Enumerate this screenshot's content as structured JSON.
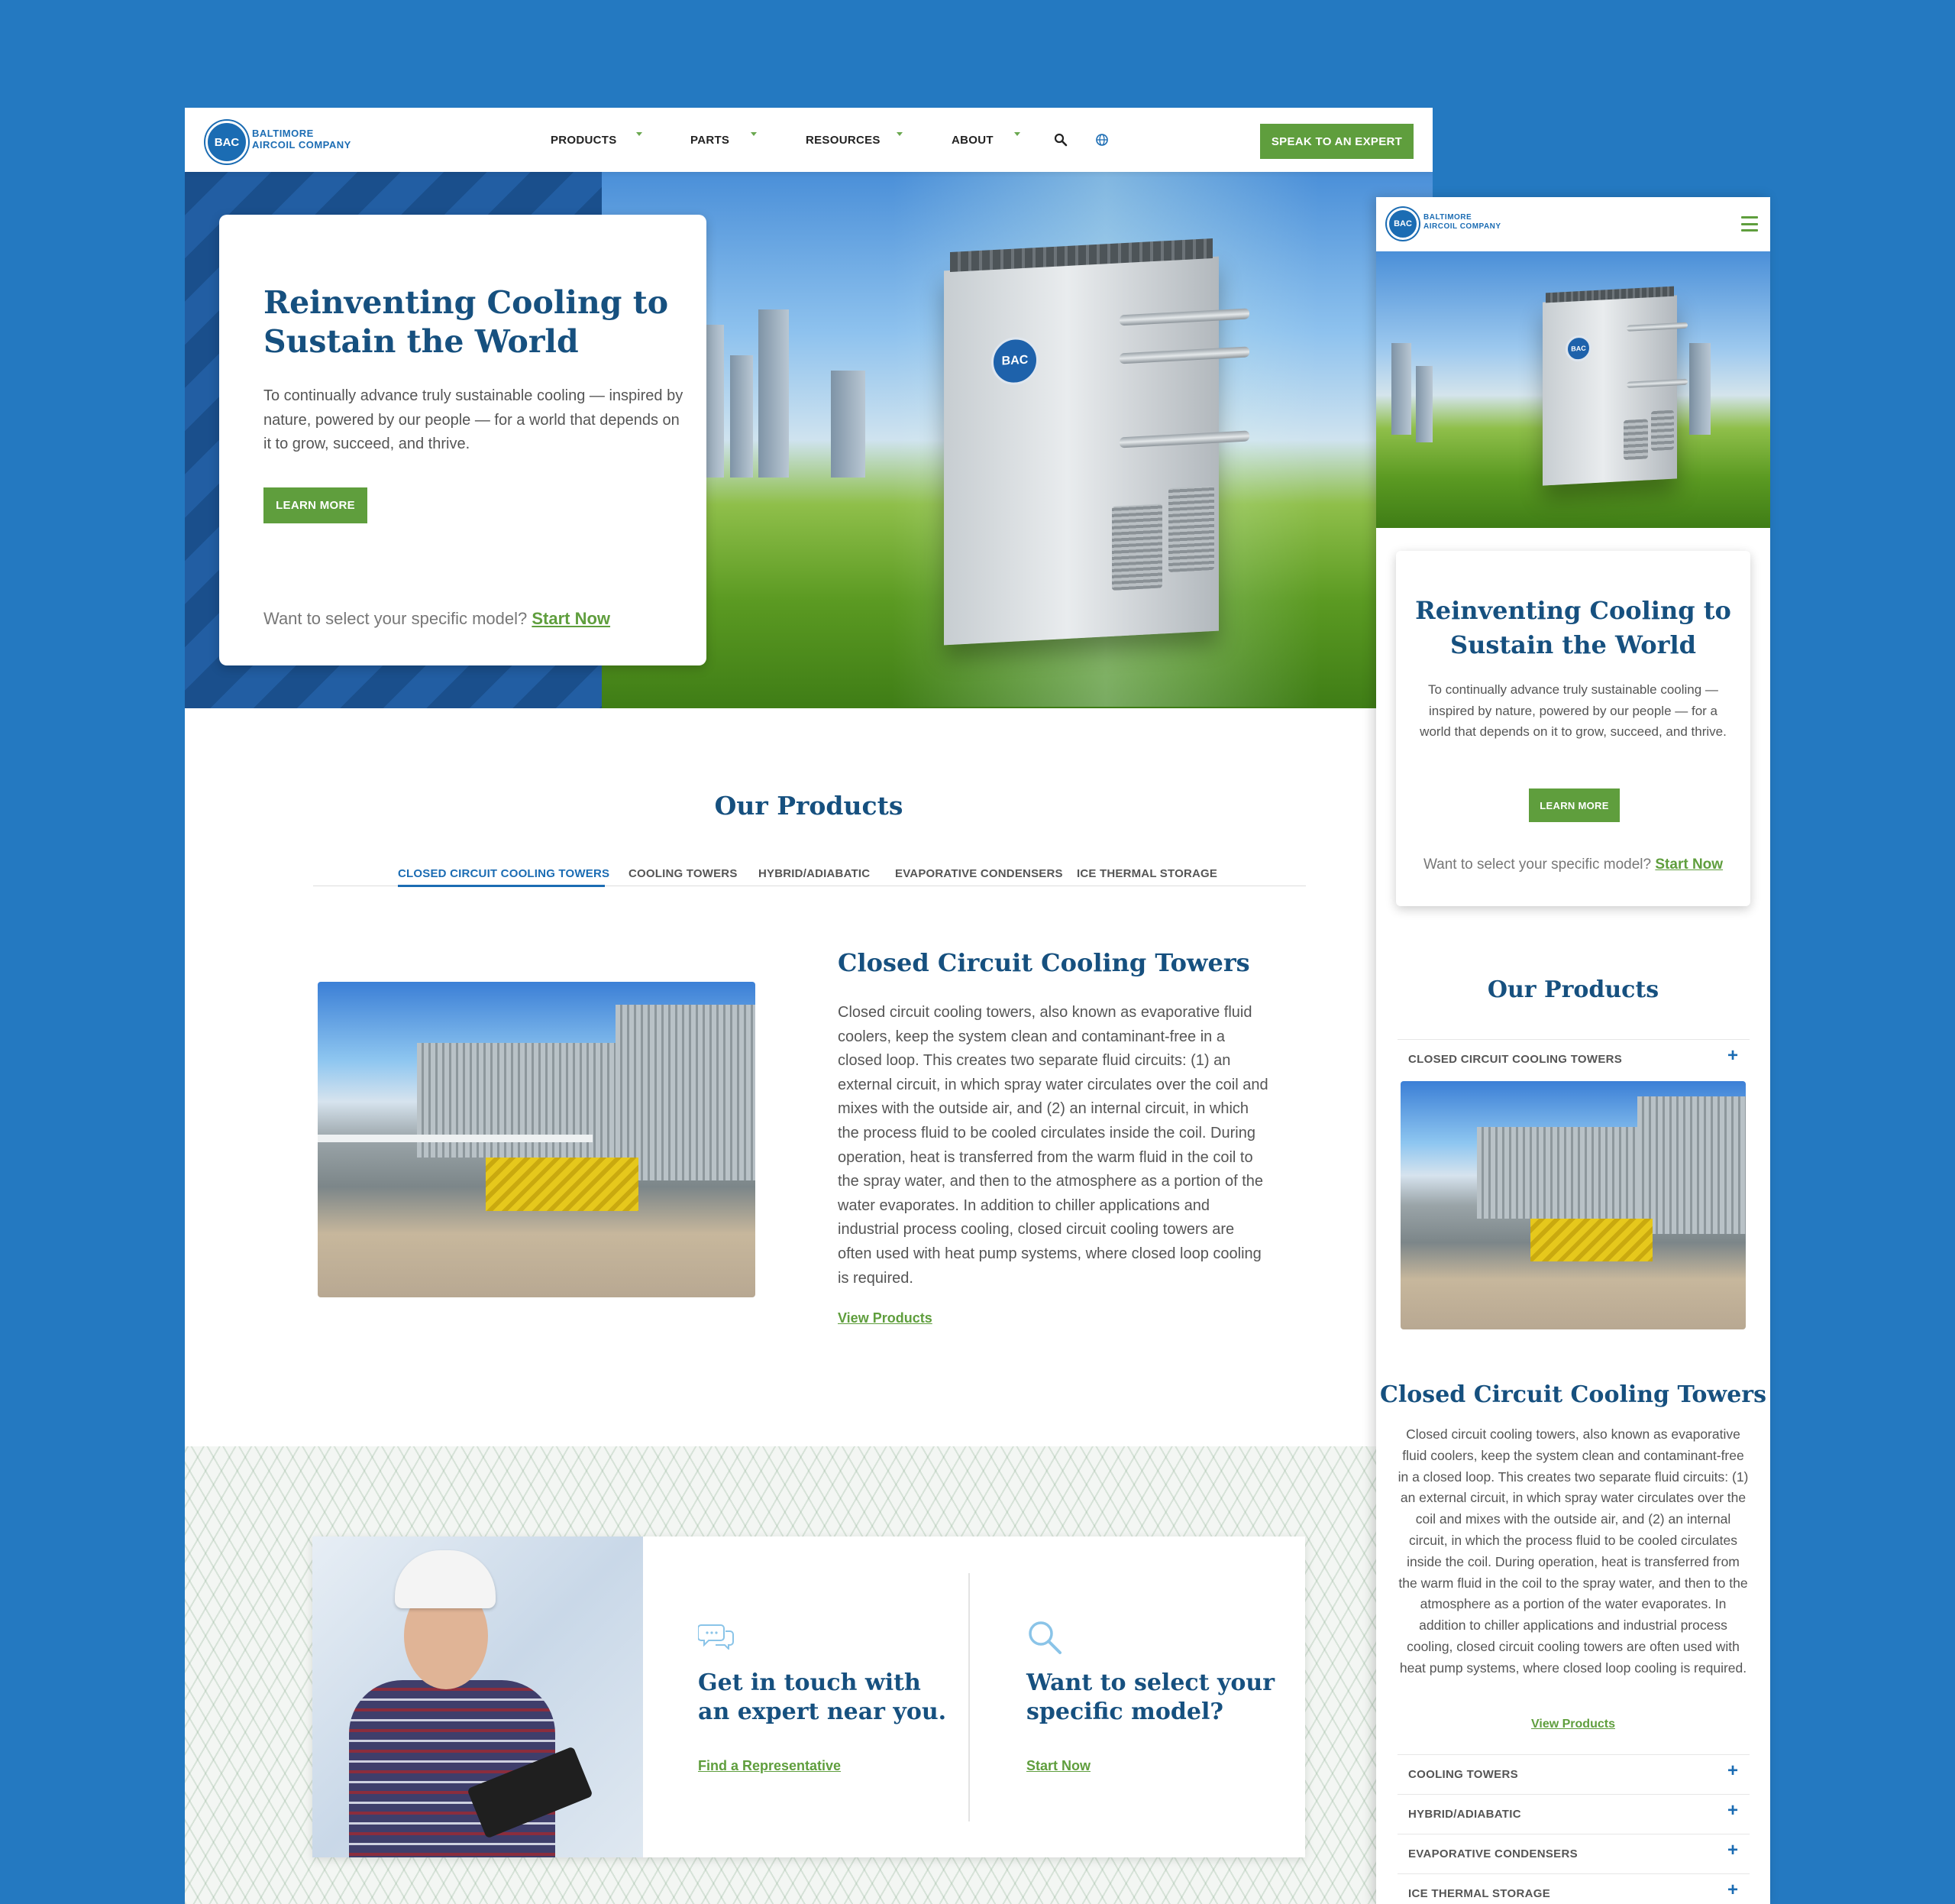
{
  "brand": {
    "logo_mark": "BAC",
    "name_line1": "BALTIMORE",
    "name_line2": "AIRCOIL COMPANY",
    "accent_blue": "#1b6cb3",
    "accent_green": "#5f9e3d",
    "title_navy": "#16507f",
    "background": "#2479c1"
  },
  "nav": {
    "items": [
      "PRODUCTS",
      "PARTS",
      "RESOURCES",
      "ABOUT"
    ],
    "search_icon": "search-icon",
    "globe_icon": "globe-icon",
    "cta": "SPEAK TO AN EXPERT"
  },
  "hero": {
    "title_line1": "Reinventing Cooling to",
    "title_line2": "Sustain the World",
    "body": "To continually advance truly sustainable cooling — inspired by nature, powered by our people — for a world that depends on it to grow, succeed, and thrive.",
    "button": "LEARN MORE",
    "select_prompt": "Want to select your specific model?",
    "select_link": "Start Now"
  },
  "products": {
    "title": "Our Products",
    "tabs": [
      "CLOSED CIRCUIT COOLING TOWERS",
      "COOLING TOWERS",
      "HYBRID/ADIABATIC",
      "EVAPORATIVE CONDENSERS",
      "ICE THERMAL STORAGE"
    ],
    "active_tab": "CLOSED CIRCUIT COOLING TOWERS",
    "content_title": "Closed Circuit Cooling Towers",
    "content_body": "Closed circuit cooling towers, also known as evaporative fluid coolers, keep the system clean and contaminant-free in a closed loop. This creates two separate fluid circuits: (1) an external circuit, in which spray water circulates over the coil and mixes with the outside air, and (2) an internal circuit, in which the process fluid to be cooled circulates inside the coil. During operation, heat is transferred from the warm fluid in the coil to the spray water, and then to the atmosphere as a portion of the water evaporates. In addition to chiller applications and industrial process cooling, closed circuit cooling towers are often used with heat pump systems, where closed loop cooling is required.",
    "view_link": "View Products"
  },
  "cta": {
    "contact_icon": "chat-bubbles-icon",
    "contact_title_line1": "Get in touch with",
    "contact_title_line2": "an expert near you.",
    "contact_link": "Find a Representative",
    "select_icon": "magnifier-icon",
    "select_title_line1": "Want to select your",
    "select_title_line2": "specific model?",
    "select_link": "Start Now"
  },
  "mobile": {
    "menu_icon": "hamburger-icon",
    "hero_title_line1": "Reinventing Cooling to",
    "hero_title_line2": "Sustain the World",
    "accordion": [
      "CLOSED CIRCUIT COOLING TOWERS",
      "COOLING TOWERS",
      "HYBRID/ADIABATIC",
      "EVAPORATIVE CONDENSERS",
      "ICE THERMAL STORAGE"
    ],
    "accordion_icon": "plus-icon"
  }
}
